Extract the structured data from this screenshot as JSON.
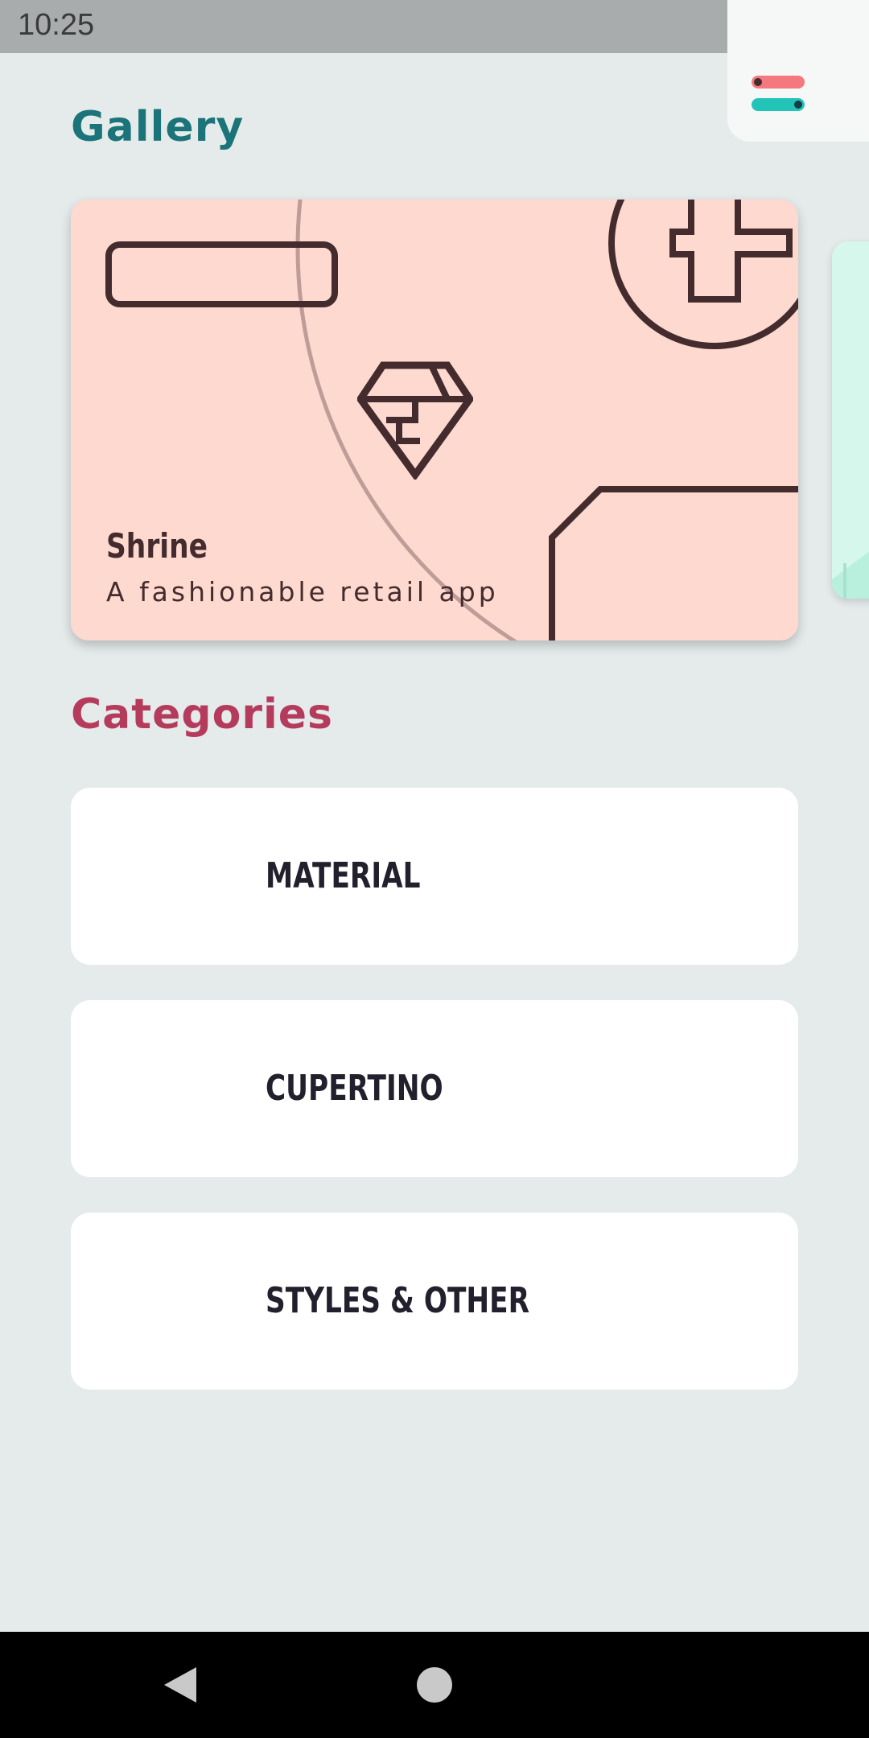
{
  "status_bar": {
    "time": "10:25",
    "battery_icon": "battery-icon"
  },
  "settings": {
    "icon": "settings-toggle-icon",
    "colors": [
      "#f4787d",
      "#22c4b8"
    ]
  },
  "gallery": {
    "title": "Gallery",
    "cards": [
      {
        "title": "Shrine",
        "subtitle": "A fashionable retail app",
        "background": "#fdd9d0",
        "accent": "#442b2d"
      }
    ],
    "next_card_color": "#d6f7ec"
  },
  "categories": {
    "title": "Categories",
    "items": [
      {
        "label": "MATERIAL"
      },
      {
        "label": "CUPERTINO"
      },
      {
        "label": "STYLES & OTHER"
      }
    ]
  },
  "colors": {
    "background": "#e5ebeb",
    "gallery_title": "#1b7479",
    "categories_title": "#b53b5d",
    "category_text": "#23202d"
  },
  "nav_bar": {
    "back_icon": "back-icon",
    "home_icon": "home-icon"
  }
}
